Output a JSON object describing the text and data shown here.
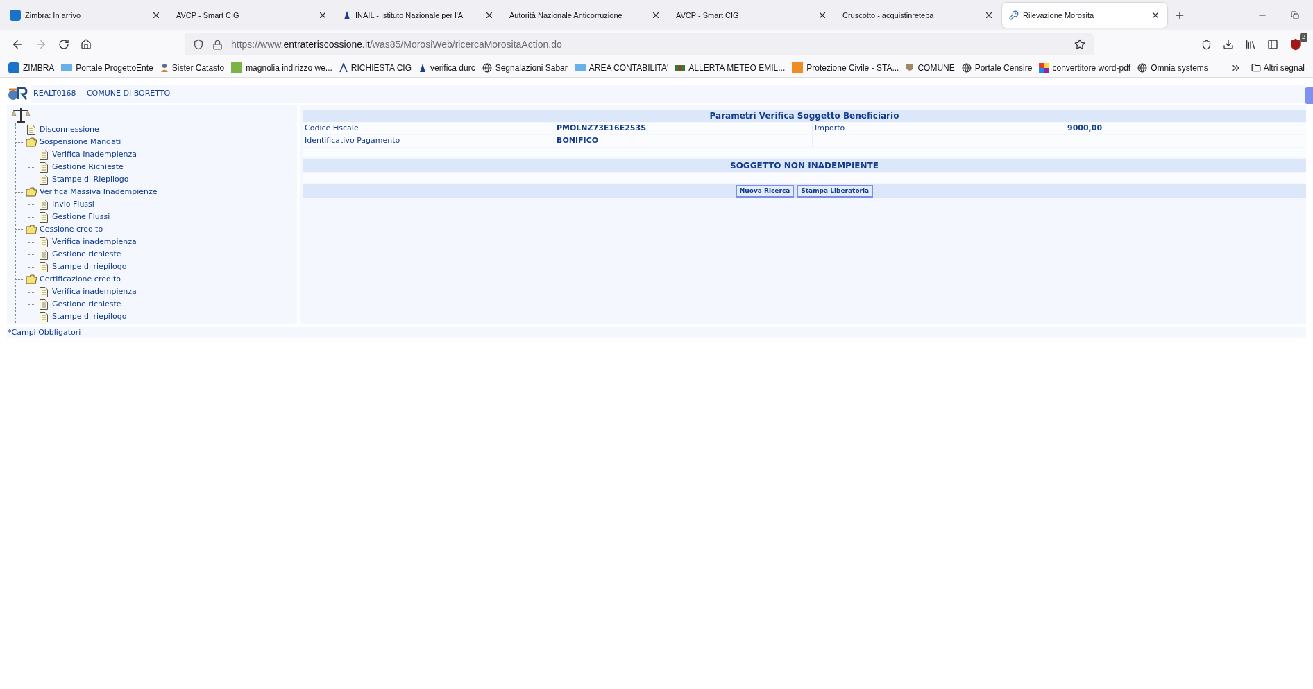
{
  "browser": {
    "tabs": [
      {
        "title": "Zimbra: In arrivo",
        "selected": false
      },
      {
        "title": "AVCP - Smart CIG",
        "selected": false
      },
      {
        "title": "INAIL - Istituto Nazionale per l'A",
        "selected": false
      },
      {
        "title": "Autorità Nazionale Anticorruzione",
        "selected": false
      },
      {
        "title": "AVCP - Smart CIG",
        "selected": false
      },
      {
        "title": "Cruscotto - acquistinretepa",
        "selected": false
      },
      {
        "title": "Rilevazione Morosita",
        "selected": true
      }
    ],
    "url": {
      "prefix": "https://www.",
      "domain": "entrateriscossione.it",
      "path": "/was85/MorosiWeb/ricercaMorositaAction.do"
    },
    "extension_badge": "2",
    "bookmarks": [
      "ZIMBRA",
      "Portale ProgettoEnte",
      "Sister Catasto",
      "magnolia indirizzo we...",
      "RICHIESTA CIG",
      "verifica durc",
      "Segnalazioni Sabar",
      "AREA CONTABILITA'",
      "ALLERTA METEO EMIL...",
      "Protezione Civile - STA...",
      "COMUNE",
      "Portale Censire",
      "convertitore word-pdf",
      "Omnia systems"
    ],
    "other_bookmarks": "Altri segnal"
  },
  "header": {
    "code": "REALT0168",
    "entity": "- COMUNE DI BORETTO"
  },
  "tree": [
    {
      "label": "Disconnessione",
      "kind": "page"
    },
    {
      "label": "Sospensione Mandati",
      "kind": "folder",
      "children": [
        {
          "label": "Verifica Inadempienza",
          "kind": "page"
        },
        {
          "label": "Gestione Richieste",
          "kind": "page"
        },
        {
          "label": "Stampe di Riepilogo",
          "kind": "page"
        }
      ]
    },
    {
      "label": "Verifica Massiva Inadempienze",
      "kind": "folder",
      "children": [
        {
          "label": "Invio Flussi",
          "kind": "page"
        },
        {
          "label": "Gestione Flussi",
          "kind": "page"
        }
      ]
    },
    {
      "label": "Cessione credito",
      "kind": "folder",
      "children": [
        {
          "label": "Verifica inadempienza",
          "kind": "page"
        },
        {
          "label": "Gestione richieste",
          "kind": "page"
        },
        {
          "label": "Stampe di riepilogo",
          "kind": "page"
        }
      ]
    },
    {
      "label": "Certificazione credito",
      "kind": "folder",
      "children": [
        {
          "label": "Verifica inadempienza",
          "kind": "page"
        },
        {
          "label": "Gestione richieste",
          "kind": "page"
        },
        {
          "label": "Stampe di riepilogo",
          "kind": "page"
        }
      ]
    }
  ],
  "panel": {
    "title": "Parametri Verifica Soggetto Beneficiario",
    "fields": [
      {
        "label": "Codice Fiscale",
        "value": "PMOLNZ73E16E253S",
        "label_2": "Importo",
        "value_2": "9000,00"
      },
      {
        "label": "Identificativo Pagamento",
        "value": "BONIFICO"
      }
    ],
    "result": "SOGGETTO NON INADEMPIENTE",
    "buttons": [
      "Nuova Ricerca",
      "Stampa Liberatoria"
    ]
  },
  "footer_note": "*Campi Obbligatori"
}
